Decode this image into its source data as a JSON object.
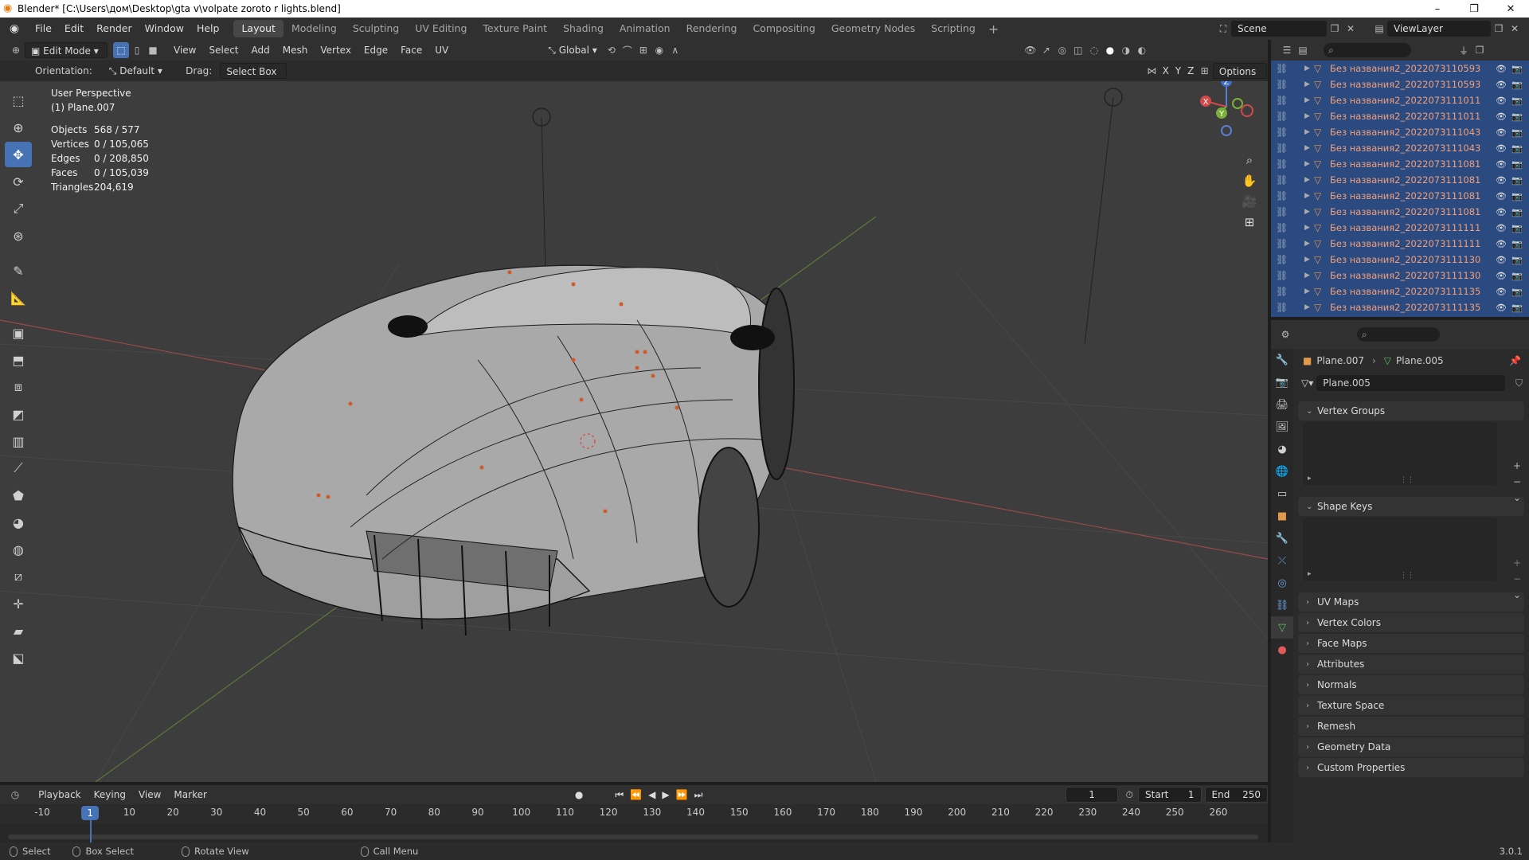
{
  "window": {
    "title": "Blender* [C:\\Users\\дом\\Desktop\\gta v\\volpate zoroto r lights.blend]",
    "minimize": "–",
    "maximize": "❐",
    "close": "✕"
  },
  "menu": [
    "File",
    "Edit",
    "Render",
    "Window",
    "Help"
  ],
  "workspaces": [
    "Layout",
    "Modeling",
    "Sculpting",
    "UV Editing",
    "Texture Paint",
    "Shading",
    "Animation",
    "Rendering",
    "Compositing",
    "Geometry Nodes",
    "Scripting"
  ],
  "active_workspace": "Layout",
  "scene": {
    "scene_name": "Scene",
    "view_layer": "ViewLayer"
  },
  "editor_header": {
    "mode": "Edit Mode",
    "menus": [
      "View",
      "Select",
      "Add",
      "Mesh",
      "Vertex",
      "Edge",
      "Face",
      "UV"
    ],
    "transform_orientation": "Global"
  },
  "tool_header": {
    "orientation_label": "Orientation:",
    "orientation_value": "Default",
    "drag_label": "Drag:",
    "drag_value": "Select Box",
    "axes": [
      "X",
      "Y",
      "Z"
    ],
    "options": "Options"
  },
  "viewport": {
    "perspective": "User Perspective",
    "object": "(1) Plane.007",
    "stats": [
      {
        "label": "Objects",
        "value": "568 / 577"
      },
      {
        "label": "Vertices",
        "value": "0 / 105,065"
      },
      {
        "label": "Edges",
        "value": "0 / 208,850"
      },
      {
        "label": "Faces",
        "value": "0 / 105,039"
      },
      {
        "label": "Triangles",
        "value": "204,619"
      }
    ],
    "gizmo": {
      "x": "X",
      "y": "Y",
      "z": "Z"
    }
  },
  "outliner": {
    "items": [
      "Без названия2_2022073110593",
      "Без названия2_2022073110593",
      "Без названия2_2022073111011",
      "Без названия2_2022073111011",
      "Без названия2_2022073111043",
      "Без названия2_2022073111043",
      "Без названия2_2022073111081",
      "Без названия2_2022073111081",
      "Без названия2_2022073111081",
      "Без названия2_2022073111081",
      "Без названия2_2022073111111",
      "Без названия2_2022073111111",
      "Без названия2_2022073111130",
      "Без названия2_2022073111130",
      "Без названия2_2022073111135",
      "Без названия2_2022073111135"
    ]
  },
  "properties": {
    "breadcrumb_object": "Plane.007",
    "breadcrumb_data": "Plane.005",
    "datablock_name": "Plane.005",
    "open_panels": [
      "Vertex Groups",
      "Shape Keys"
    ],
    "closed_panels": [
      "UV Maps",
      "Vertex Colors",
      "Face Maps",
      "Attributes",
      "Normals",
      "Texture Space",
      "Remesh",
      "Geometry Data",
      "Custom Properties"
    ]
  },
  "timeline": {
    "menus": [
      "Playback",
      "Keying",
      "View",
      "Marker"
    ],
    "current_frame": "1",
    "start_label": "Start",
    "start_value": "1",
    "end_label": "End",
    "end_value": "250",
    "ticks": [
      "-10",
      "1",
      "10",
      "20",
      "30",
      "40",
      "50",
      "60",
      "70",
      "80",
      "90",
      "100",
      "110",
      "120",
      "130",
      "140",
      "150",
      "160",
      "170",
      "180",
      "190",
      "200",
      "210",
      "220",
      "230",
      "240",
      "250",
      "260"
    ]
  },
  "statusbar": {
    "select": "Select",
    "box_select": "Box Select",
    "rotate_view": "Rotate View",
    "call_menu": "Call Menu",
    "version": "3.0.1"
  },
  "colors": {
    "accent": "#4772b3",
    "outliner_selected": "#2a4a80",
    "object_name": "#f0a07c",
    "viewport_bg": "#3d3d3d"
  }
}
